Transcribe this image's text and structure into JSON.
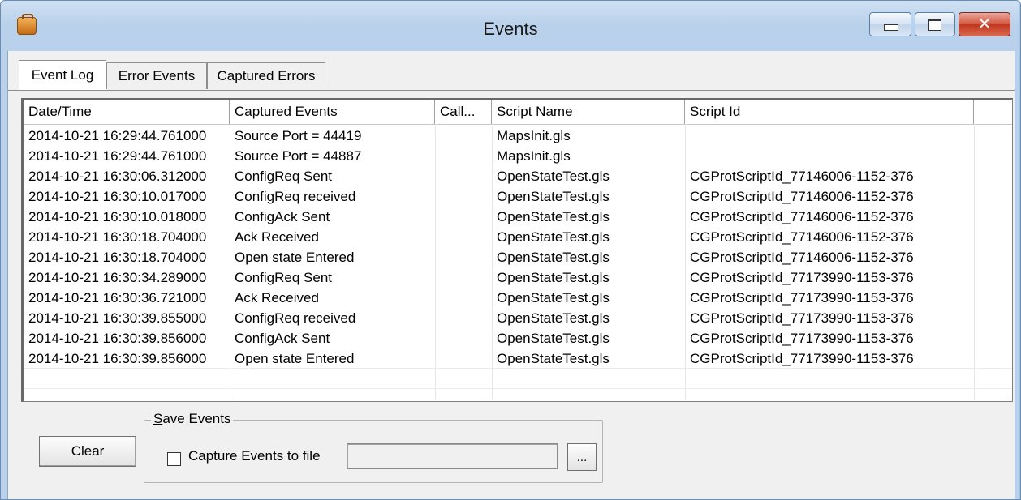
{
  "window": {
    "title": "Events"
  },
  "title_buttons": {
    "minimize": "minimize",
    "maximize": "maximize",
    "close": "✕"
  },
  "tabs": [
    {
      "label": "Event Log",
      "active": true
    },
    {
      "label": "Error Events",
      "active": false
    },
    {
      "label": "Captured Errors",
      "active": false
    }
  ],
  "table": {
    "columns": [
      "Date/Time",
      "Captured Events",
      "Call...",
      "Script Name",
      "Script Id"
    ],
    "rows": [
      [
        "2014-10-21 16:29:44.761000",
        "Source Port = 44419",
        "",
        "MapsInit.gls",
        ""
      ],
      [
        "2014-10-21 16:29:44.761000",
        "Source Port = 44887",
        "",
        "MapsInit.gls",
        ""
      ],
      [
        "2014-10-21 16:30:06.312000",
        "ConfigReq Sent",
        "",
        "OpenStateTest.gls",
        "CGProtScriptId_77146006-1152-376"
      ],
      [
        "2014-10-21 16:30:10.017000",
        "ConfigReq received",
        "",
        "OpenStateTest.gls",
        "CGProtScriptId_77146006-1152-376"
      ],
      [
        "2014-10-21 16:30:10.018000",
        "ConfigAck Sent",
        "",
        "OpenStateTest.gls",
        "CGProtScriptId_77146006-1152-376"
      ],
      [
        "2014-10-21 16:30:18.704000",
        "Ack Received",
        "",
        "OpenStateTest.gls",
        "CGProtScriptId_77146006-1152-376"
      ],
      [
        "2014-10-21 16:30:18.704000",
        "Open state Entered",
        "",
        "OpenStateTest.gls",
        "CGProtScriptId_77146006-1152-376"
      ],
      [
        "2014-10-21 16:30:34.289000",
        "ConfigReq Sent",
        "",
        "OpenStateTest.gls",
        "CGProtScriptId_77173990-1153-376"
      ],
      [
        "2014-10-21 16:30:36.721000",
        "Ack Received",
        "",
        "OpenStateTest.gls",
        "CGProtScriptId_77173990-1153-376"
      ],
      [
        "2014-10-21 16:30:39.855000",
        "ConfigReq received",
        "",
        "OpenStateTest.gls",
        "CGProtScriptId_77173990-1153-376"
      ],
      [
        "2014-10-21 16:30:39.856000",
        "ConfigAck Sent",
        "",
        "OpenStateTest.gls",
        "CGProtScriptId_77173990-1153-376"
      ],
      [
        "2014-10-21 16:30:39.856000",
        "Open state Entered",
        "",
        "OpenStateTest.gls",
        "CGProtScriptId_77173990-1153-376"
      ]
    ]
  },
  "buttons": {
    "clear": "Clear",
    "browse": "..."
  },
  "save_events": {
    "group_label_access_key": "S",
    "group_label_rest": "ave Events",
    "checkbox_label": "Capture Events to file",
    "checked": false,
    "file_path": ""
  }
}
